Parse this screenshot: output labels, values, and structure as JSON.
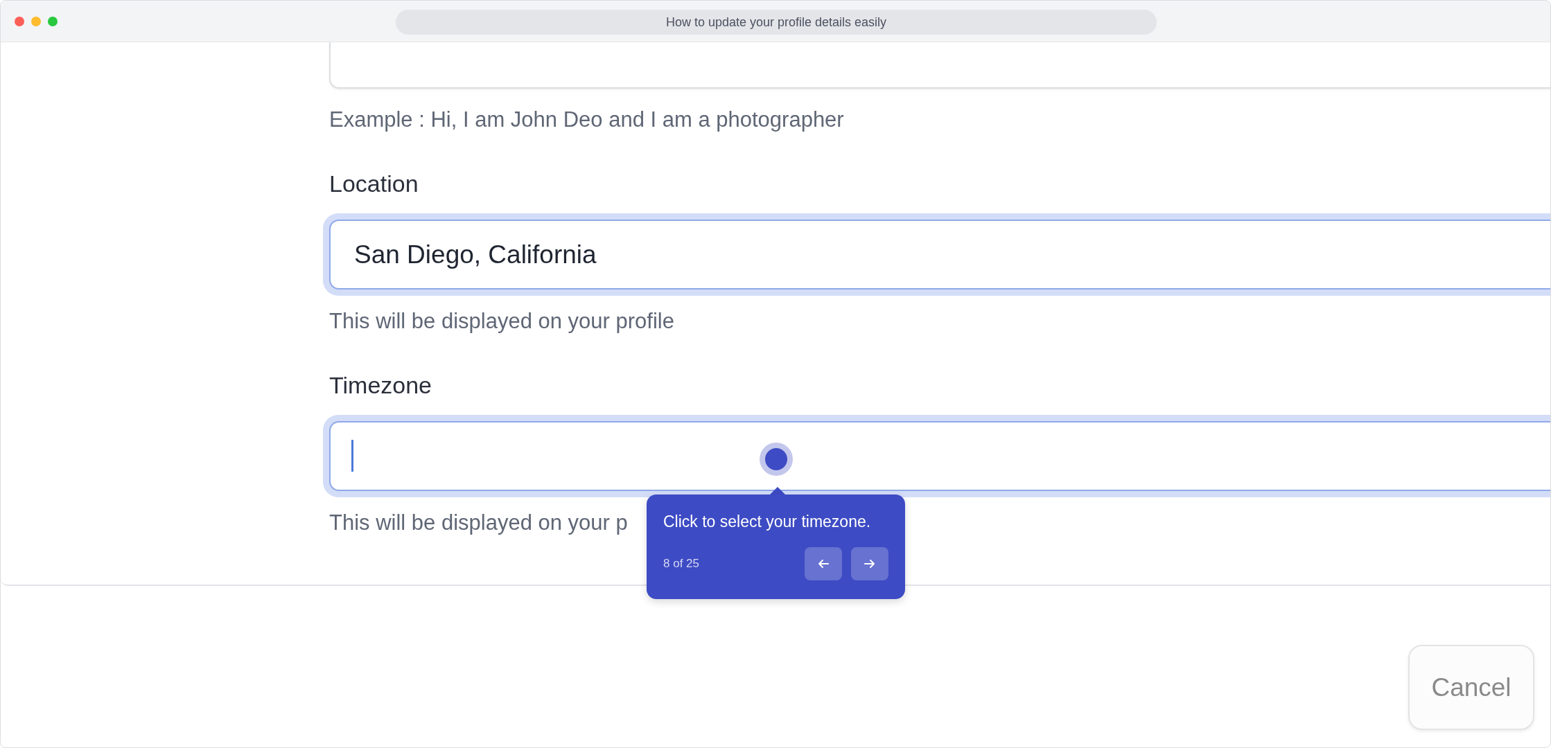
{
  "window": {
    "title": "How to update your profile details easily"
  },
  "fields": [
    {
      "kind": "textarea",
      "helper": "Example : Hi, I am John Deo and I am a photographer"
    },
    {
      "kind": "text",
      "label": "Location",
      "value": "San Diego, California",
      "focused": true,
      "helper": "This will be displayed on your profile"
    },
    {
      "kind": "text",
      "label": "Timezone",
      "focused": true,
      "helper": "This will be displayed on your p"
    }
  ],
  "tour": {
    "text": "Click to select your timezone.",
    "progress": "8 of 25"
  },
  "buttons": [
    {
      "label": "Cancel"
    }
  ]
}
